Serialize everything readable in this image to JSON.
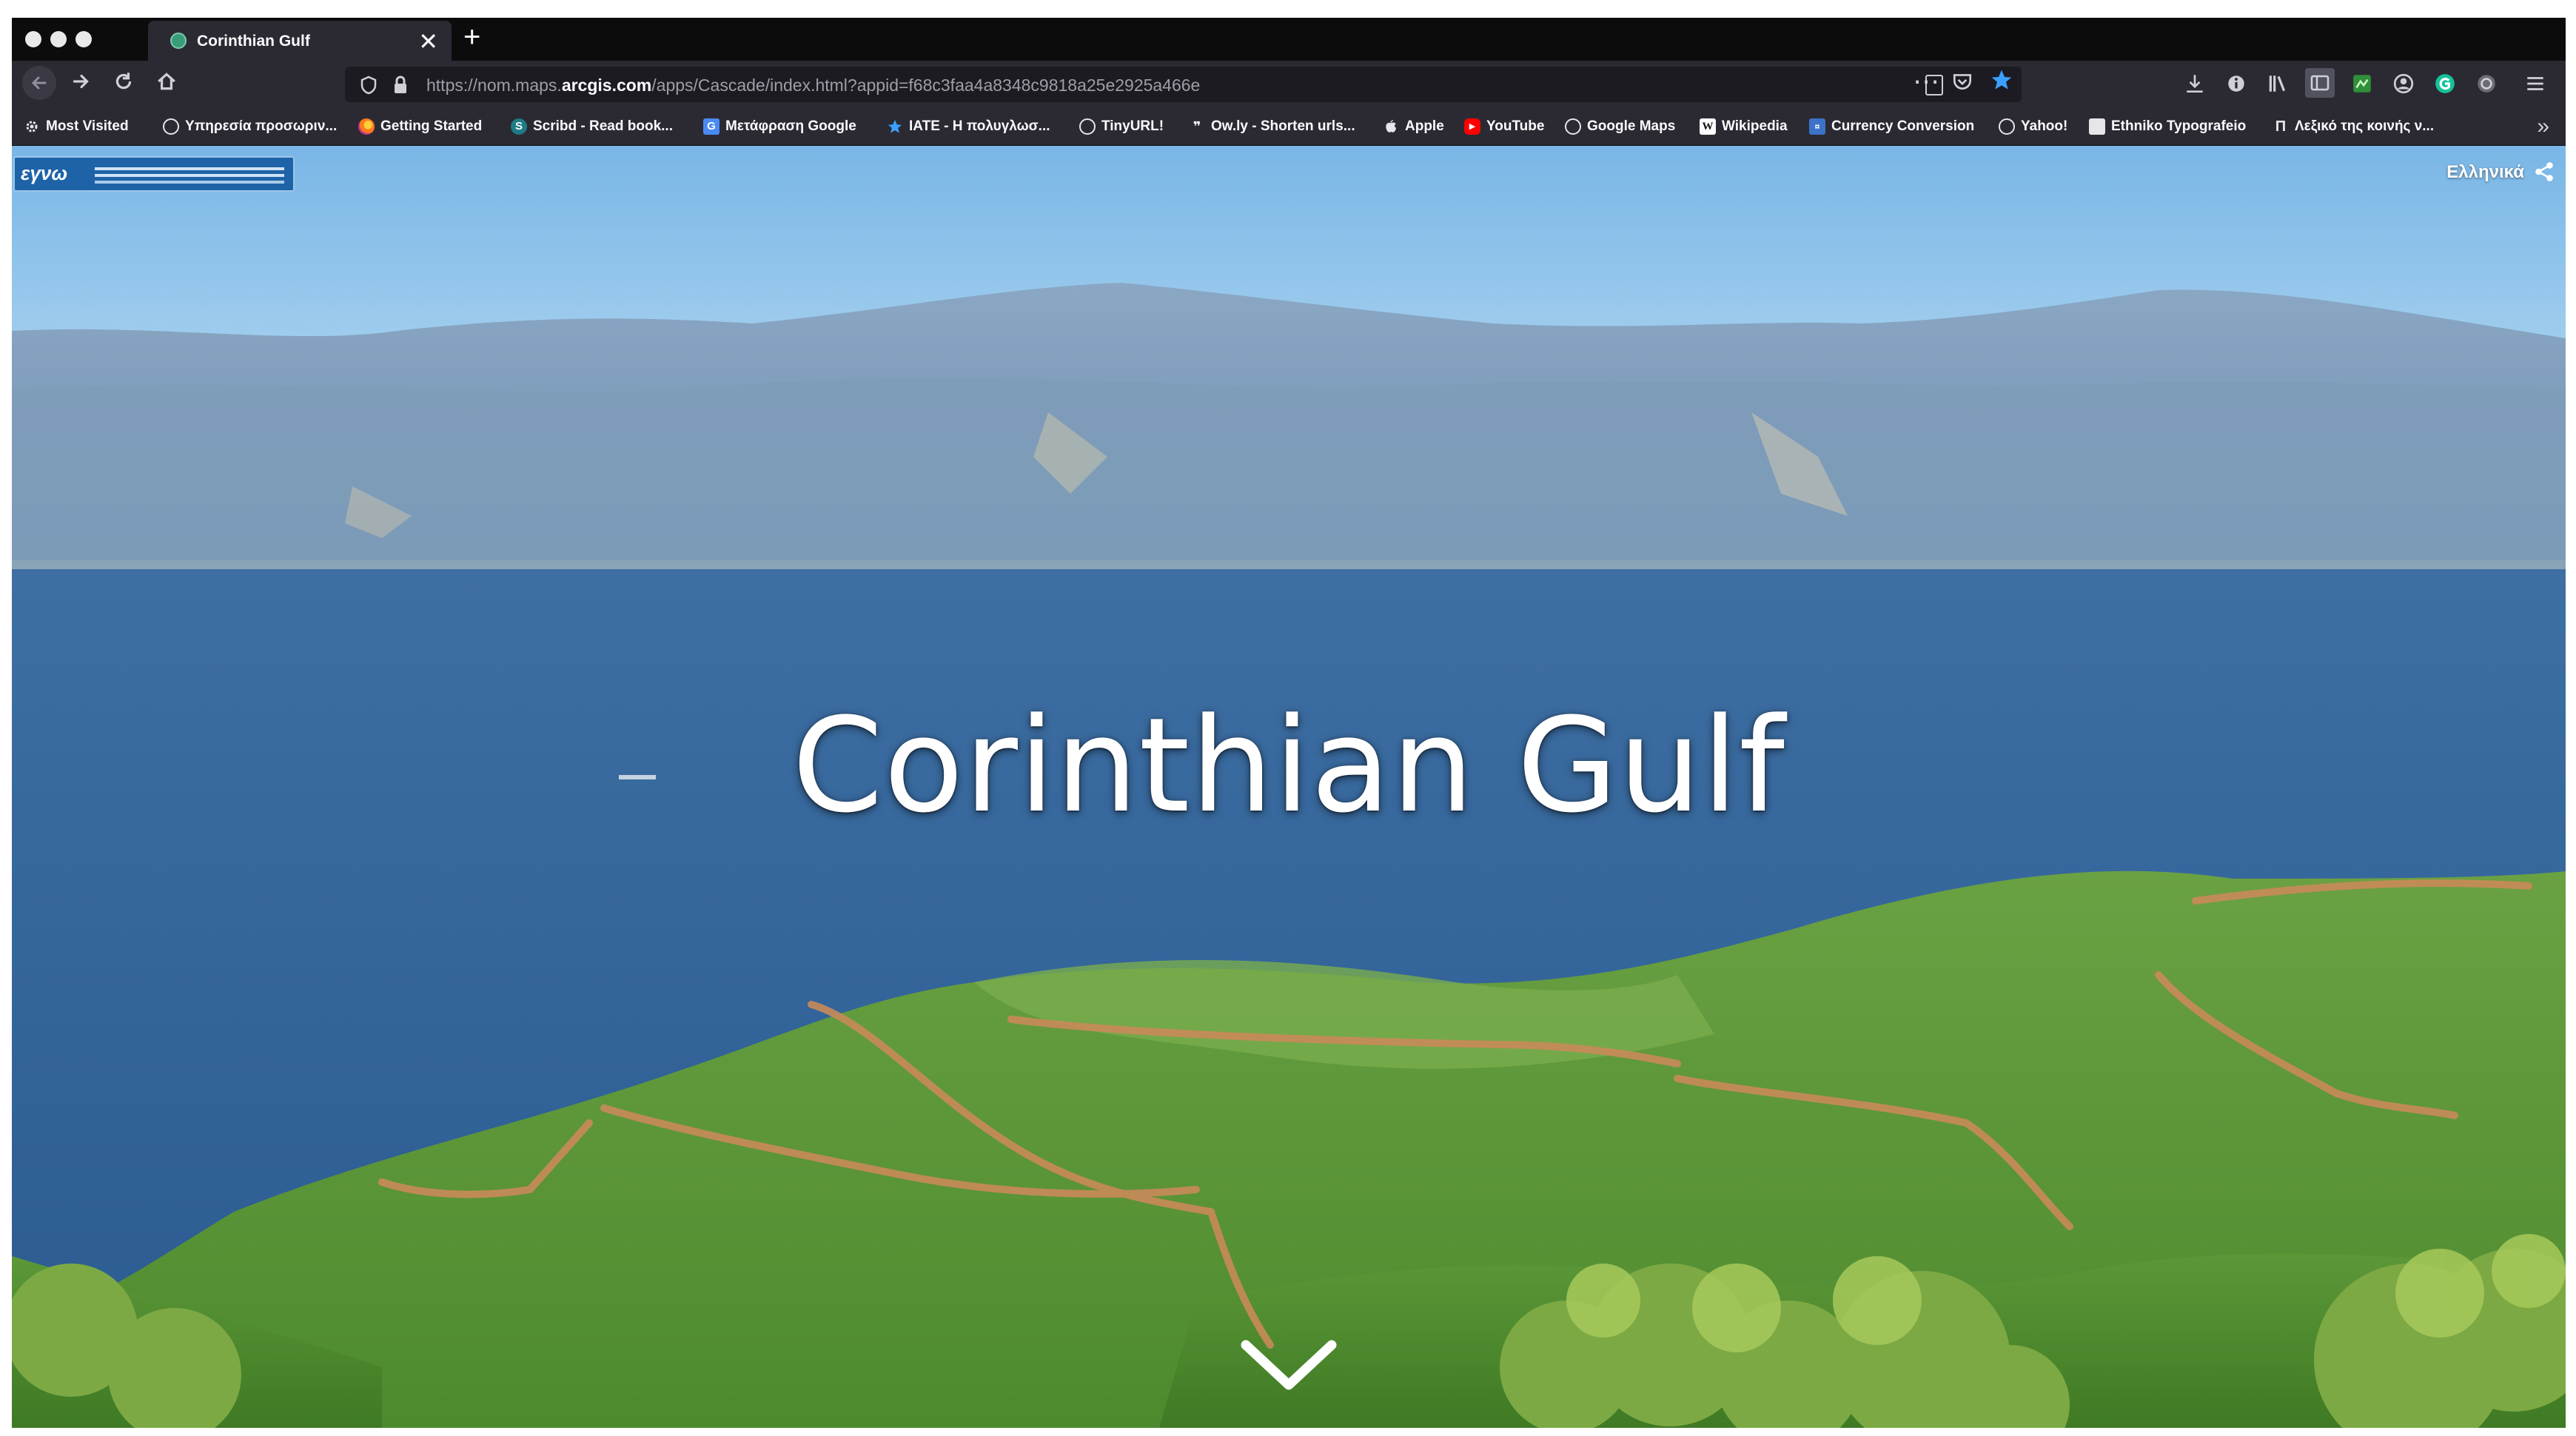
{
  "browser": {
    "tab": {
      "title": "Corinthian Gulf",
      "close_glyph": "✕"
    },
    "new_tab_glyph": "+",
    "url": {
      "prefix": "https://nom.maps.",
      "domain": "arcgis.com",
      "suffix": "/apps/Cascade/index.html?appid=f68c3faa4a8348c9818a25e2925a466e"
    },
    "url_more_glyph": "⋯",
    "bookmarks_more_glyph": "»",
    "bookmarks": [
      {
        "label": "Most Visited",
        "icon": "gear-icon"
      },
      {
        "label": "Υπηρεσία προσωριν...",
        "icon": "globe-icon"
      },
      {
        "label": "Getting Started",
        "icon": "firefox-icon"
      },
      {
        "label": "Scribd - Read book...",
        "icon": "scribd-icon"
      },
      {
        "label": "Μετάφραση Google",
        "icon": "translate-icon"
      },
      {
        "label": "IATE - Η πολυγλωσ...",
        "icon": "star-icon"
      },
      {
        "label": "TinyURL!",
        "icon": "globe-icon"
      },
      {
        "label": "Ow.ly - Shorten urls...",
        "icon": "owly-icon"
      },
      {
        "label": "Apple",
        "icon": "apple-icon"
      },
      {
        "label": "YouTube",
        "icon": "youtube-icon"
      },
      {
        "label": "Google Maps",
        "icon": "globe-icon"
      },
      {
        "label": "Wikipedia",
        "icon": "wikipedia-icon"
      },
      {
        "label": "Currency Conversion",
        "icon": "currency-icon"
      },
      {
        "label": "Yahoo!",
        "icon": "globe-icon"
      },
      {
        "label": "Ethniko Typografeio",
        "icon": "document-icon"
      },
      {
        "label": "Λεξικό της κοινής ν...",
        "icon": "pi-icon"
      }
    ]
  },
  "story": {
    "title": "Corinthian Gulf",
    "language_label": "Ελληνικά",
    "logo_text": "εγνω"
  },
  "colors": {
    "brand_blue": "#1e63a8",
    "star_blue": "#3aa0ff",
    "youtube_red": "#ff0000"
  }
}
